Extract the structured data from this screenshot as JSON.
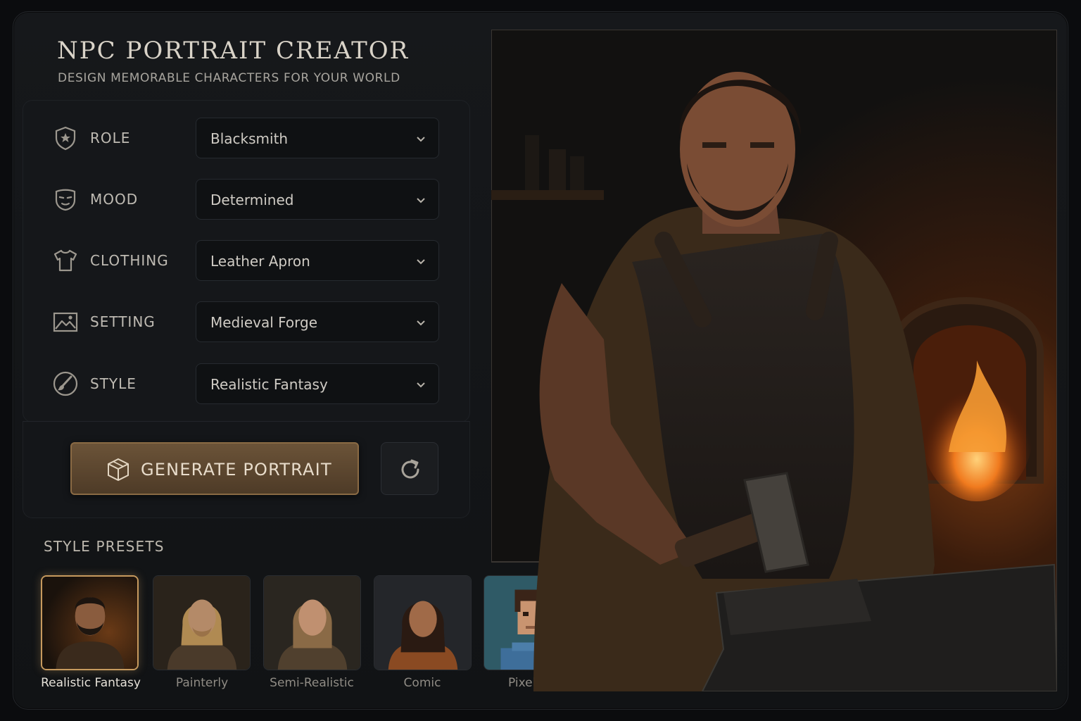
{
  "header": {
    "title": "NPC PORTRAIT CREATOR",
    "subtitle": "DESIGN MEMORABLE CHARACTERS FOR YOUR WORLD"
  },
  "fields": [
    {
      "label": "ROLE",
      "value": "Blacksmith",
      "icon": "shield-icon"
    },
    {
      "label": "MOOD",
      "value": "Determined",
      "icon": "mask-icon"
    },
    {
      "label": "CLOTHING",
      "value": "Leather Apron",
      "icon": "shirt-icon"
    },
    {
      "label": "SETTING",
      "value": "Medieval Forge",
      "icon": "landscape-icon"
    },
    {
      "label": "STYLE",
      "value": "Realistic Fantasy",
      "icon": "brush-icon"
    }
  ],
  "actions": {
    "generate_label": "GENERATE PORTRAIT",
    "generate_icon": "cube-icon",
    "refresh_icon": "refresh-icon"
  },
  "presets": {
    "title": "STYLE PRESETS",
    "items": [
      {
        "label": "Realistic Fantasy",
        "selected": true
      },
      {
        "label": "Painterly",
        "selected": false
      },
      {
        "label": "Semi-Realistic",
        "selected": false
      },
      {
        "label": "Comic",
        "selected": false
      },
      {
        "label": "Pixel Art",
        "selected": false
      }
    ]
  },
  "colors": {
    "accent": "#c79a5e",
    "button": "#5c4630",
    "background": "#111315"
  }
}
